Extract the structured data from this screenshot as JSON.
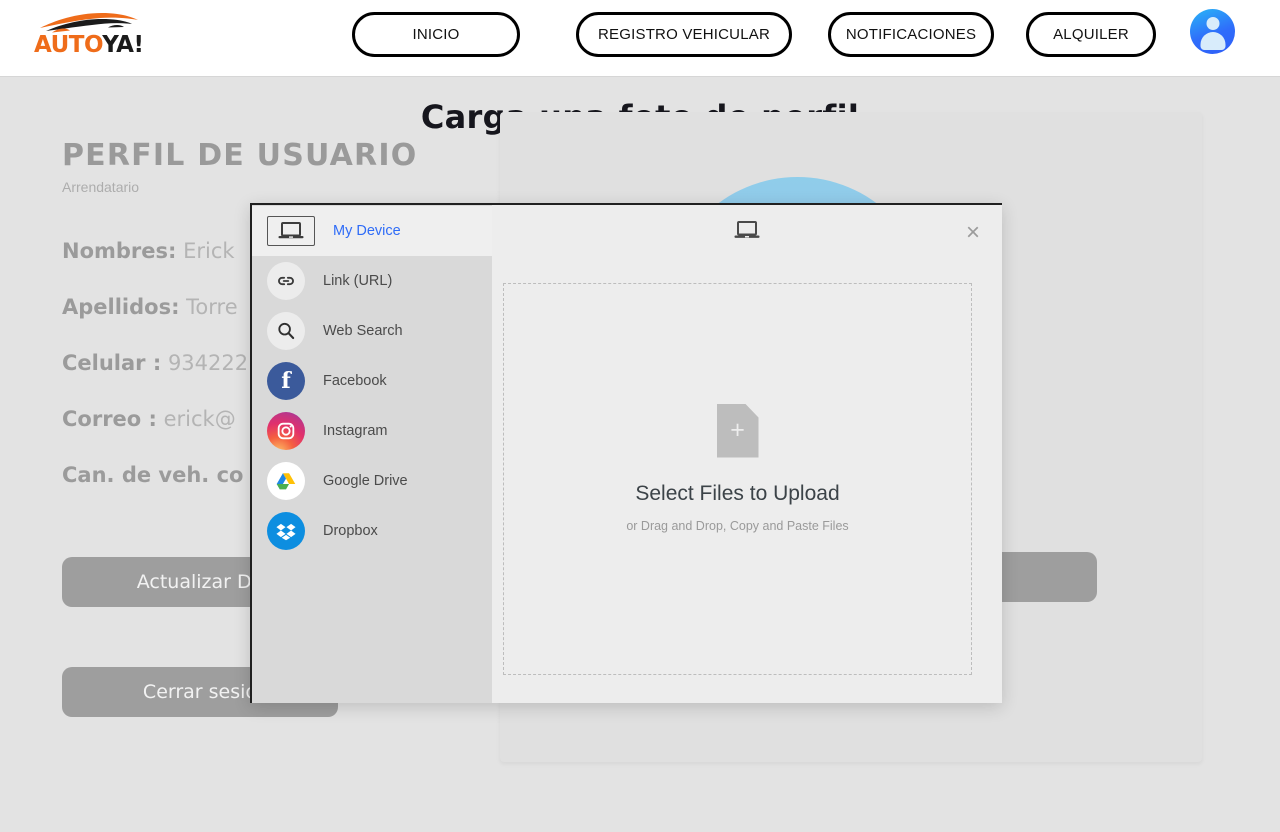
{
  "brand": {
    "name_part1": "AUTO",
    "name_part2": "YA!",
    "logo_icon": "car-silhouette-icon"
  },
  "nav": {
    "items": [
      {
        "label": "INICIO",
        "name": "nav-inicio"
      },
      {
        "label": "REGISTRO VEHICULAR",
        "name": "nav-registro-vehicular"
      },
      {
        "label": "NOTIFICACIONES",
        "name": "nav-notificaciones"
      },
      {
        "label": "ALQUILER",
        "name": "nav-alquiler"
      }
    ],
    "avatar_icon": "user-avatar-icon"
  },
  "page": {
    "title": "Carga una foto de perfil"
  },
  "profile": {
    "heading": "PERFIL DE USUARIO",
    "subheading": "Arrendatario",
    "fields": [
      {
        "label": "Nombres:",
        "value": "Erick"
      },
      {
        "label": "Apellidos:",
        "value": "Torre"
      },
      {
        "label": "Celular :",
        "value": "934222"
      },
      {
        "label": "Correo :",
        "value": "erick@"
      },
      {
        "label": "Can. de veh. co",
        "value": ""
      }
    ],
    "update_button": "Actualizar Da",
    "logout_button": "Cerrar sesió"
  },
  "uploader": {
    "header_icon": "laptop-icon",
    "close_icon": "×",
    "sidebar": [
      {
        "label": "My Device",
        "icon": "laptop-icon",
        "active": true
      },
      {
        "label": "Link (URL)",
        "icon": "link-icon",
        "active": false
      },
      {
        "label": "Web Search",
        "icon": "search-icon",
        "active": false
      },
      {
        "label": "Facebook",
        "icon": "facebook-icon",
        "active": false
      },
      {
        "label": "Instagram",
        "icon": "instagram-icon",
        "active": false
      },
      {
        "label": "Google Drive",
        "icon": "google-drive-icon",
        "active": false
      },
      {
        "label": "Dropbox",
        "icon": "dropbox-icon",
        "active": false
      }
    ],
    "dropzone": {
      "icon": "file-add-icon",
      "title": "Select Files to Upload",
      "subtitle": "or Drag and Drop, Copy and Paste Files"
    }
  },
  "colors": {
    "page_background": "#e3e3e3",
    "accent_blue": "#2f6cf7",
    "brand_orange": "#ef6c1a",
    "muted_gray": "#9e9e9e",
    "modal_background": "#ededed",
    "sidebar_background": "#d9d9d9",
    "card_background": "#e0e0e0"
  }
}
